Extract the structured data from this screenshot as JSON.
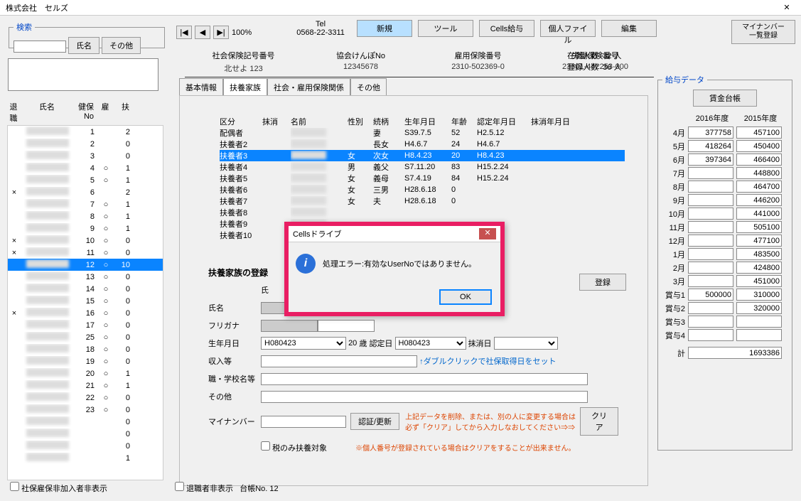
{
  "title": "株式会社　セルズ",
  "search": {
    "legend": "検索",
    "btn_name": "氏名",
    "btn_other": "その他"
  },
  "topnav": {
    "zoom": "100%",
    "tel_lbl": "Tel",
    "tel": "0568-22-3311",
    "btns": [
      "新規",
      "ツール",
      "Cells給与",
      "個人ファイル",
      "編集",
      "マイナンバー一覧登録"
    ]
  },
  "info": {
    "cols": [
      {
        "lbl": "社会保険記号番号",
        "val": "北せよ 123"
      },
      {
        "lbl": "協会けんぽNo",
        "val": "12345678"
      },
      {
        "lbl": "雇用保険番号",
        "val": "2310-502369-0"
      },
      {
        "lbl": "労働保険番号",
        "val": "23301-442253-000"
      }
    ],
    "count": [
      [
        "在職人数",
        "32",
        "人"
      ],
      [
        "登録人数",
        "36",
        "人"
      ]
    ]
  },
  "tabs": [
    "基本情報",
    "扶養家族",
    "社会・雇用保険関係",
    "その他"
  ],
  "tabs_active": 1,
  "left_hdr": [
    "退職",
    "氏名",
    "健保No",
    "雇",
    "扶"
  ],
  "left_rows": [
    {
      "ret": "",
      "no": "1",
      "emp": "",
      "dep": "2"
    },
    {
      "ret": "",
      "no": "2",
      "emp": "",
      "dep": "0"
    },
    {
      "ret": "",
      "no": "3",
      "emp": "",
      "dep": "0"
    },
    {
      "ret": "",
      "no": "4",
      "emp": "○",
      "dep": "1"
    },
    {
      "ret": "",
      "no": "5",
      "emp": "○",
      "dep": "1"
    },
    {
      "ret": "×",
      "no": "6",
      "emp": "",
      "dep": "2"
    },
    {
      "ret": "",
      "no": "7",
      "emp": "○",
      "dep": "1"
    },
    {
      "ret": "",
      "no": "8",
      "emp": "○",
      "dep": "1"
    },
    {
      "ret": "",
      "no": "9",
      "emp": "○",
      "dep": "1"
    },
    {
      "ret": "×",
      "no": "10",
      "emp": "○",
      "dep": "0"
    },
    {
      "ret": "×",
      "no": "11",
      "emp": "○",
      "dep": "0"
    },
    {
      "ret": "",
      "no": "12",
      "emp": "○",
      "dep": "10",
      "sel": true
    },
    {
      "ret": "",
      "no": "13",
      "emp": "○",
      "dep": "0"
    },
    {
      "ret": "",
      "no": "14",
      "emp": "○",
      "dep": "0"
    },
    {
      "ret": "",
      "no": "15",
      "emp": "○",
      "dep": "0"
    },
    {
      "ret": "×",
      "no": "16",
      "emp": "○",
      "dep": "0"
    },
    {
      "ret": "",
      "no": "17",
      "emp": "○",
      "dep": "0"
    },
    {
      "ret": "",
      "no": "25",
      "emp": "○",
      "dep": "0"
    },
    {
      "ret": "",
      "no": "18",
      "emp": "○",
      "dep": "0"
    },
    {
      "ret": "",
      "no": "19",
      "emp": "○",
      "dep": "0"
    },
    {
      "ret": "",
      "no": "20",
      "emp": "○",
      "dep": "1"
    },
    {
      "ret": "",
      "no": "21",
      "emp": "○",
      "dep": "1"
    },
    {
      "ret": "",
      "no": "22",
      "emp": "○",
      "dep": "0"
    },
    {
      "ret": "",
      "no": "23",
      "emp": "○",
      "dep": "0"
    },
    {
      "ret": "",
      "no": "",
      "emp": "",
      "dep": "0"
    },
    {
      "ret": "",
      "no": "",
      "emp": "",
      "dep": "0"
    },
    {
      "ret": "",
      "no": "",
      "emp": "",
      "dep": "0"
    },
    {
      "ret": "",
      "no": "",
      "emp": "",
      "dep": "1"
    }
  ],
  "dep_hdr": [
    "区分",
    "抹消",
    "名前",
    "性別",
    "続柄",
    "生年月日",
    "年齢",
    "認定年月日",
    "抹消年月日"
  ],
  "dep_rows": [
    {
      "k": "配偶者",
      "sex": "",
      "rel": "妻",
      "dob": "S39.7.5",
      "age": "52",
      "nin": "H2.5.12"
    },
    {
      "k": "扶養者2",
      "sex": "",
      "rel": "長女",
      "dob": "H4.6.7",
      "age": "24",
      "nin": "H4.6.7"
    },
    {
      "k": "扶養者3",
      "sex": "女",
      "rel": "次女",
      "dob": "H8.4.23",
      "age": "20",
      "nin": "H8.4.23",
      "sel": true
    },
    {
      "k": "扶養者4",
      "sex": "男",
      "rel": "義父",
      "dob": "S7.11.20",
      "age": "83",
      "nin": "H15.2.24"
    },
    {
      "k": "扶養者5",
      "sex": "女",
      "rel": "義母",
      "dob": "S7.4.19",
      "age": "84",
      "nin": "H15.2.24"
    },
    {
      "k": "扶養者6",
      "sex": "女",
      "rel": "三男",
      "dob": "H28.6.18",
      "age": "0",
      "nin": ""
    },
    {
      "k": "扶養者7",
      "sex": "女",
      "rel": "夫",
      "dob": "H28.6.18",
      "age": "0",
      "nin": ""
    },
    {
      "k": "扶養者8"
    },
    {
      "k": "扶養者9"
    },
    {
      "k": "扶養者10"
    }
  ],
  "reg": {
    "title": "扶養家族の登録",
    "btn": "登録",
    "labels": {
      "shi": "氏",
      "name": "氏名",
      "kana": "フリガナ",
      "dob": "生年月日",
      "age_suf": "歳",
      "nin": "認定日",
      "del": "抹消日",
      "income": "収入等",
      "school": "職・学校名等",
      "other": "その他",
      "myno": "マイナンバー",
      "auth": "認証/更新",
      "clear": "クリア",
      "taxonly": "税のみ扶養対象",
      "hint": "↑ダブルクリックで社保取得日をセット",
      "note1": "上記データを削除、または、別の人に変更する場合は必ず「クリア」してから入力しなおしてください⇒⇒",
      "note2": "※個人番号が登録されている場合はクリアをすることが出来ません。"
    },
    "vals": {
      "dob": "H080423",
      "age": "20",
      "nin": "H080423"
    }
  },
  "salary": {
    "legend": "給与データ",
    "btn": "賃金台帳",
    "years": [
      "2016年度",
      "2015年度"
    ],
    "rows": [
      {
        "m": "4月",
        "a": "377758",
        "b": "457100"
      },
      {
        "m": "5月",
        "a": "418264",
        "b": "450400"
      },
      {
        "m": "6月",
        "a": "397364",
        "b": "466400"
      },
      {
        "m": "7月",
        "a": "",
        "b": "448800"
      },
      {
        "m": "8月",
        "a": "",
        "b": "464700"
      },
      {
        "m": "9月",
        "a": "",
        "b": "446200"
      },
      {
        "m": "10月",
        "a": "",
        "b": "441000"
      },
      {
        "m": "11月",
        "a": "",
        "b": "505100"
      },
      {
        "m": "12月",
        "a": "",
        "b": "477100"
      },
      {
        "m": "1月",
        "a": "",
        "b": "483500"
      },
      {
        "m": "2月",
        "a": "",
        "b": "424800"
      },
      {
        "m": "3月",
        "a": "",
        "b": "451000"
      },
      {
        "m": "賞与1",
        "a": "500000",
        "b": "310000"
      },
      {
        "m": "賞与2",
        "a": "",
        "b": "320000"
      },
      {
        "m": "賞与3",
        "a": "",
        "b": ""
      },
      {
        "m": "賞与4",
        "a": "",
        "b": ""
      }
    ],
    "total_lbl": "計",
    "total": "1693386"
  },
  "footer": {
    "ck1": "社保雇保非加入者非表示",
    "ck2": "退職者非表示",
    "ledger_lbl": "台帳No.",
    "ledger": "12"
  },
  "dialog": {
    "title": "Cellsドライブ",
    "msg": "処理エラー:有効なUserNoではありません。",
    "ok": "OK"
  }
}
